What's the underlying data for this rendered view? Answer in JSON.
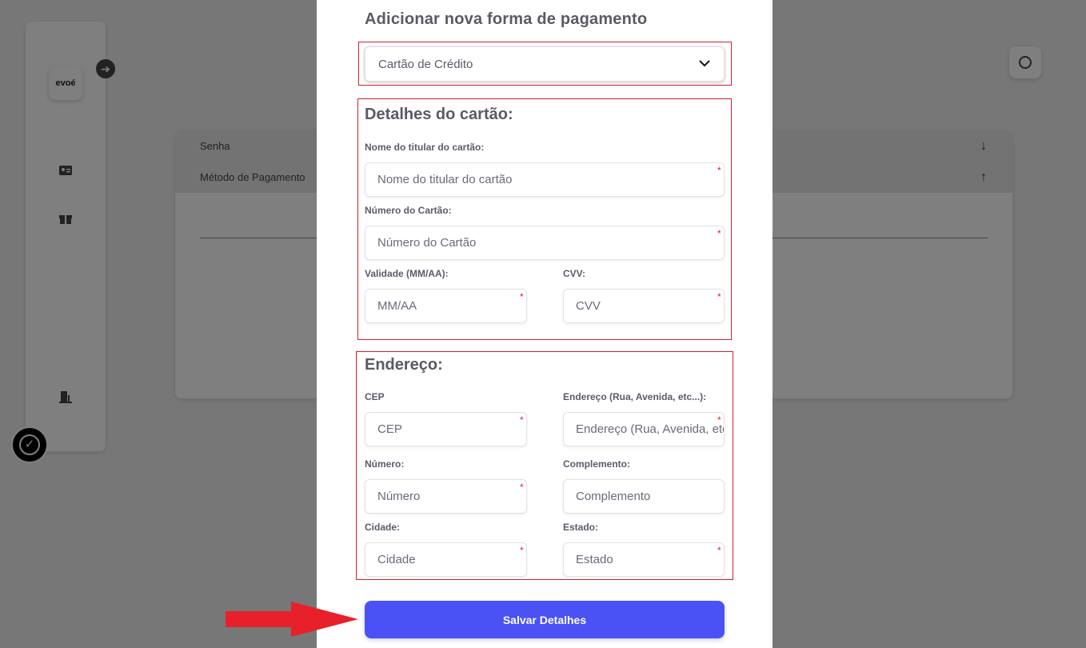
{
  "app": {
    "logo_text": "evoé"
  },
  "sidebar": {
    "icons": [
      "id-card-icon",
      "gift-icon",
      "door-exit-icon"
    ]
  },
  "accordion": [
    {
      "label": "Senha",
      "arrow": "↓"
    },
    {
      "label": "Método de Pagamento",
      "arrow": "↑"
    }
  ],
  "modal": {
    "title": "Adicionar nova forma de pagamento",
    "payment_select": {
      "value": "Cartão de Crédito"
    },
    "card_section": {
      "title": "Detalhes do cartão:",
      "holder_label": "Nome do titular do cartão:",
      "holder_placeholder": "Nome do titular do cartão",
      "number_label": "Número do Cartão:",
      "number_placeholder": "Número do Cartão",
      "expiry_label": "Validade (MM/AA):",
      "expiry_placeholder": "MM/AA",
      "cvv_label": "CVV:",
      "cvv_placeholder": "CVV"
    },
    "address_section": {
      "title": "Endereço:",
      "cep_label": "CEP",
      "cep_placeholder": "CEP",
      "street_label": "Endereço (Rua, Avenida, etc...):",
      "street_placeholder": "Endereço (Rua, Avenida, etc...)",
      "number_label": "Número:",
      "number_placeholder": "Número",
      "complement_label": "Complemento:",
      "complement_placeholder": "Complemento",
      "city_label": "Cidade:",
      "city_placeholder": "Cidade",
      "state_label": "Estado:",
      "state_placeholder": "Estado"
    },
    "save_label": "Salvar Detalhes",
    "required_mark": "*"
  },
  "colors": {
    "primary": "#4a52f5",
    "highlight": "#cc2233",
    "annotation_arrow": "#e8202a"
  }
}
